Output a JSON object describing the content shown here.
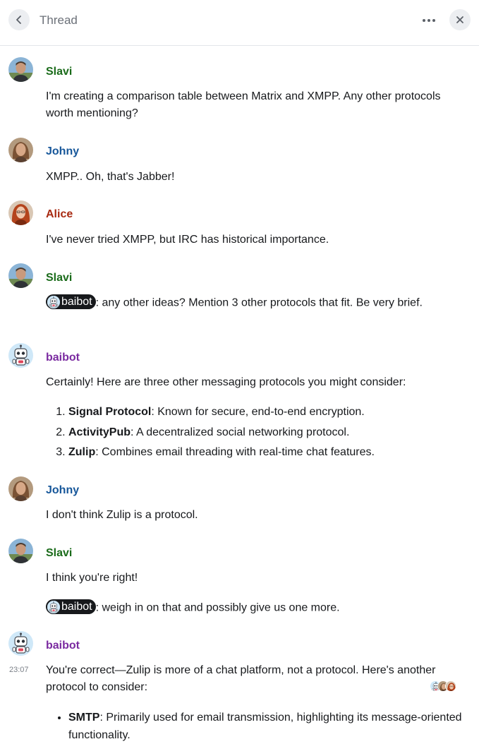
{
  "header": {
    "title": "Thread",
    "back_icon": "chevron-left-icon",
    "more_icon": "more-horizontal-icon",
    "close_icon": "close-icon"
  },
  "colors": {
    "slavi": "#1a6b1a",
    "johny": "#17579a",
    "alice": "#a82a12",
    "baibot": "#7a2aa0",
    "mention_pill": "#17191c"
  },
  "messages": [
    {
      "sender": "Slavi",
      "text": "I'm creating a comparison table between Matrix and XMPP. Any other protocols worth mentioning?"
    },
    {
      "sender": "Johny",
      "text": "XMPP.. Oh, that's Jabber!"
    },
    {
      "sender": "Alice",
      "text": "I've never tried XMPP, but IRC has historical importance."
    },
    {
      "sender": "Slavi",
      "mention": "baibot",
      "text": ": any other ideas? Mention 3 other protocols that fit. Be very brief."
    },
    {
      "sender": "baibot",
      "intro": "Certainly! Here are three other messaging protocols you might consider:",
      "items": [
        {
          "bold": "Signal Protocol",
          "rest": ": Known for secure, end-to-end encryption."
        },
        {
          "bold": "ActivityPub",
          "rest": ": A decentralized social networking protocol."
        },
        {
          "bold": "Zulip",
          "rest": ": Combines email threading with real-time chat features."
        }
      ]
    },
    {
      "sender": "Johny",
      "text": "I don't think Zulip is a protocol."
    },
    {
      "sender": "Slavi",
      "text": "I think you're right!",
      "mention": "baibot",
      "text2": ": weigh in on that and possibly give us one more."
    },
    {
      "sender": "baibot",
      "timestamp": "23:07",
      "intro": "You're correct—Zulip is more of a chat platform, not a protocol. Here's another protocol to consider:",
      "items": [
        {
          "bold": "SMTP",
          "rest": ": Primarily used for email transmission, highlighting its message-oriented functionality."
        }
      ]
    }
  ]
}
